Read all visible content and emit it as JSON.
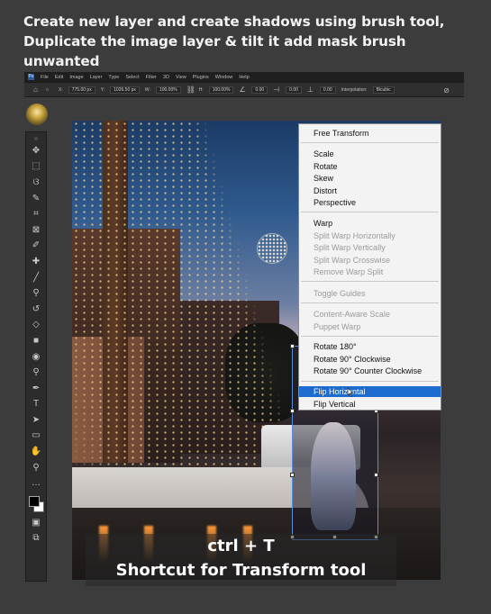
{
  "captions": {
    "top_line1": "Create new layer and create shadows using brush tool,",
    "top_line2": "Duplicate the image layer & tilt it add mask brush unwanted",
    "shortcut": "ctrl + T",
    "bottom": "Shortcut for Transform tool"
  },
  "menubar": {
    "logo": "Ps",
    "items": [
      "File",
      "Edit",
      "Image",
      "Layer",
      "Type",
      "Select",
      "Filter",
      "3D",
      "View",
      "Plugins",
      "Window",
      "Help"
    ]
  },
  "options_bar": {
    "x_label": "X:",
    "x_value": "775.00 px",
    "y_label": "Y:",
    "y_value": "1026.50 px",
    "w_label": "W:",
    "w_value": "100.00%",
    "h_label": "H:",
    "h_value": "100.00%",
    "angle_value": "0.00",
    "h_skew_value": "0.00",
    "v_skew_value": "0.00",
    "interpolation_label": "Interpolation:",
    "interpolation_value": "Bicubic"
  },
  "toolbar": {
    "icons": [
      "move-icon",
      "marquee-icon",
      "lasso-icon",
      "quick-select-icon",
      "crop-icon",
      "frame-icon",
      "eyedropper-icon",
      "healing-icon",
      "brush-icon",
      "stamp-icon",
      "history-brush-icon",
      "eraser-icon",
      "gradient-icon",
      "blur-icon",
      "dodge-icon",
      "pen-icon",
      "type-icon",
      "path-select-icon",
      "shape-icon",
      "hand-icon",
      "zoom-icon",
      "more-icon"
    ],
    "glyphs": [
      "✥",
      "⬚",
      "ଓ",
      "✎",
      "⌗",
      "⊠",
      "✐",
      "✚",
      "╱",
      "⚲",
      "↺",
      "◇",
      "■",
      "◉",
      "⚲",
      "✒",
      "T",
      "➤",
      "▭",
      "✋",
      "⚲",
      "…"
    ],
    "bottom_glyphs": [
      "▣",
      "⧉"
    ]
  },
  "context_menu": {
    "items": [
      {
        "label": "Free Transform",
        "disabled": false
      },
      {
        "label": "Scale",
        "disabled": false
      },
      {
        "label": "Rotate",
        "disabled": false
      },
      {
        "label": "Skew",
        "disabled": false
      },
      {
        "label": "Distort",
        "disabled": false
      },
      {
        "label": "Perspective",
        "disabled": false
      },
      {
        "label": "Warp",
        "disabled": false
      },
      {
        "label": "Split Warp Horizontally",
        "disabled": true
      },
      {
        "label": "Split Warp Vertically",
        "disabled": true
      },
      {
        "label": "Split Warp Crosswise",
        "disabled": true
      },
      {
        "label": "Remove Warp Split",
        "disabled": true
      },
      {
        "label": "Toggle Guides",
        "disabled": true
      },
      {
        "label": "Content-Aware Scale",
        "disabled": true
      },
      {
        "label": "Puppet Warp",
        "disabled": true
      },
      {
        "label": "Rotate 180°",
        "disabled": false
      },
      {
        "label": "Rotate 90° Clockwise",
        "disabled": false
      },
      {
        "label": "Rotate 90° Counter Clockwise",
        "disabled": false
      },
      {
        "label": "Flip Horizontal",
        "disabled": false,
        "highlighted": true
      },
      {
        "label": "Flip Vertical",
        "disabled": false
      }
    ]
  },
  "colors": {
    "menu_highlight": "#1c6cd0",
    "selection_border": "#5a8dd6",
    "app_background": "#3c3c3d"
  }
}
